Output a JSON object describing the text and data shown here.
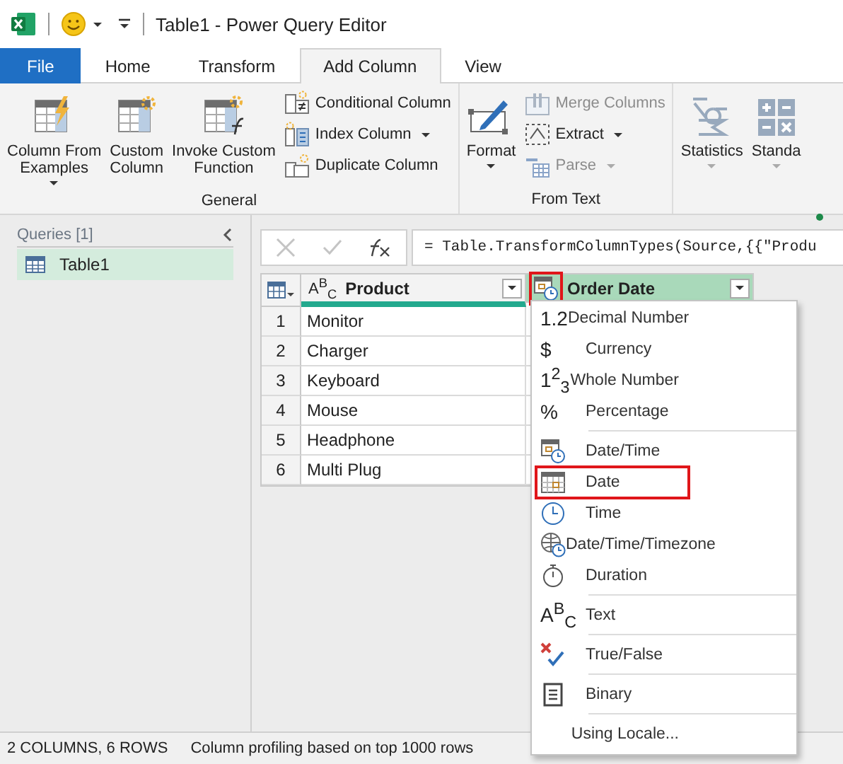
{
  "title_bar": {
    "title": "Table1 - Power Query Editor"
  },
  "ribbon_tabs": [
    {
      "label": "File",
      "kind": "file",
      "selected": false
    },
    {
      "label": "Home",
      "kind": "tab",
      "selected": false
    },
    {
      "label": "Transform",
      "kind": "tab",
      "selected": false
    },
    {
      "label": "Add Column",
      "kind": "tab",
      "selected": true
    },
    {
      "label": "View",
      "kind": "tab",
      "selected": false
    }
  ],
  "ribbon_groups": [
    {
      "label": "General",
      "items": [
        {
          "kind": "large",
          "lines": [
            "Column From",
            "Examples"
          ],
          "dropdown": true
        },
        {
          "kind": "large",
          "lines": [
            "Custom",
            "Column"
          ],
          "dropdown": false
        },
        {
          "kind": "large",
          "lines": [
            "Invoke Custom",
            "Function"
          ],
          "dropdown": false
        },
        {
          "kind": "stack",
          "buttons": [
            {
              "label": "Conditional Column",
              "dropdown": false,
              "disabled": false
            },
            {
              "label": "Index Column",
              "dropdown": true,
              "disabled": false
            },
            {
              "label": "Duplicate Column",
              "dropdown": false,
              "disabled": false
            }
          ]
        }
      ]
    },
    {
      "label": "From Text",
      "items": [
        {
          "kind": "large",
          "lines": [
            "Format"
          ],
          "dropdown": true
        },
        {
          "kind": "stack",
          "buttons": [
            {
              "label": "Merge Columns",
              "dropdown": false,
              "disabled": true
            },
            {
              "label": "Extract",
              "dropdown": true,
              "disabled": false
            },
            {
              "label": "Parse",
              "dropdown": true,
              "disabled": true
            }
          ]
        }
      ]
    },
    {
      "items": [
        {
          "kind": "large",
          "lines": [
            "Statistics"
          ],
          "dropdown": true
        },
        {
          "kind": "large",
          "lines": [
            "Standa"
          ],
          "dropdown": true
        }
      ]
    }
  ],
  "queries_panel": {
    "heading": "Queries [1]",
    "items": [
      {
        "label": "Table1",
        "selected": true
      }
    ]
  },
  "formula_bar": {
    "formula": "= Table.TransformColumnTypes(Source,{{\"Produ"
  },
  "table": {
    "columns": [
      {
        "name": "Product",
        "type_glyph": "A$^{B}$$_{C}$",
        "type_highlighted": false,
        "selected": false
      },
      {
        "name": "Order Date",
        "kind": "datetime",
        "type_highlighted": true,
        "selected": true
      }
    ],
    "rows": [
      {
        "number": "1",
        "cells": [
          "Monitor"
        ]
      },
      {
        "number": "2",
        "cells": [
          "Charger"
        ]
      },
      {
        "number": "3",
        "cells": [
          "Keyboard"
        ]
      },
      {
        "number": "4",
        "cells": [
          "Mouse"
        ]
      },
      {
        "number": "5",
        "cells": [
          "Headphone"
        ]
      },
      {
        "number": "6",
        "cells": [
          "Multi Plug"
        ]
      }
    ]
  },
  "type_menu": {
    "sections": [
      {
        "items": [
          {
            "kind": "glyph",
            "glyph": "1.2",
            "label": "Decimal Number",
            "highlighted": false
          },
          {
            "kind": "glyph",
            "glyph": "$",
            "label": "Currency",
            "highlighted": false
          },
          {
            "kind": "glyph",
            "glyph": "1$^{2}$$_{3}$",
            "label": "Whole Number",
            "highlighted": false
          },
          {
            "kind": "glyph",
            "glyph": "%",
            "label": "Percentage",
            "highlighted": false
          }
        ]
      },
      {
        "items": [
          {
            "kind": "datetime",
            "label": "Date/Time",
            "highlighted": false
          },
          {
            "kind": "date",
            "label": "Date",
            "highlighted": true
          },
          {
            "kind": "time",
            "label": "Time",
            "highlighted": false
          },
          {
            "kind": "timezone",
            "label": "Date/Time/Timezone",
            "highlighted": false
          },
          {
            "kind": "duration",
            "label": "Duration",
            "highlighted": false
          }
        ]
      },
      {
        "items": [
          {
            "kind": "glyph",
            "glyph": "A$^{B}$$_{C}$",
            "label": "Text",
            "highlighted": false
          }
        ]
      },
      {
        "items": [
          {
            "kind": "logical",
            "label": "True/False",
            "highlighted": false
          }
        ]
      },
      {
        "items": [
          {
            "kind": "binary",
            "label": "Binary",
            "highlighted": false
          }
        ]
      },
      {
        "items": [
          {
            "kind": "plain",
            "label": "Using Locale...",
            "highlighted": false
          }
        ]
      }
    ]
  },
  "status_bar": {
    "items": [
      "2 COLUMNS, 6 ROWS",
      "Column profiling based on top 1000 rows"
    ]
  }
}
